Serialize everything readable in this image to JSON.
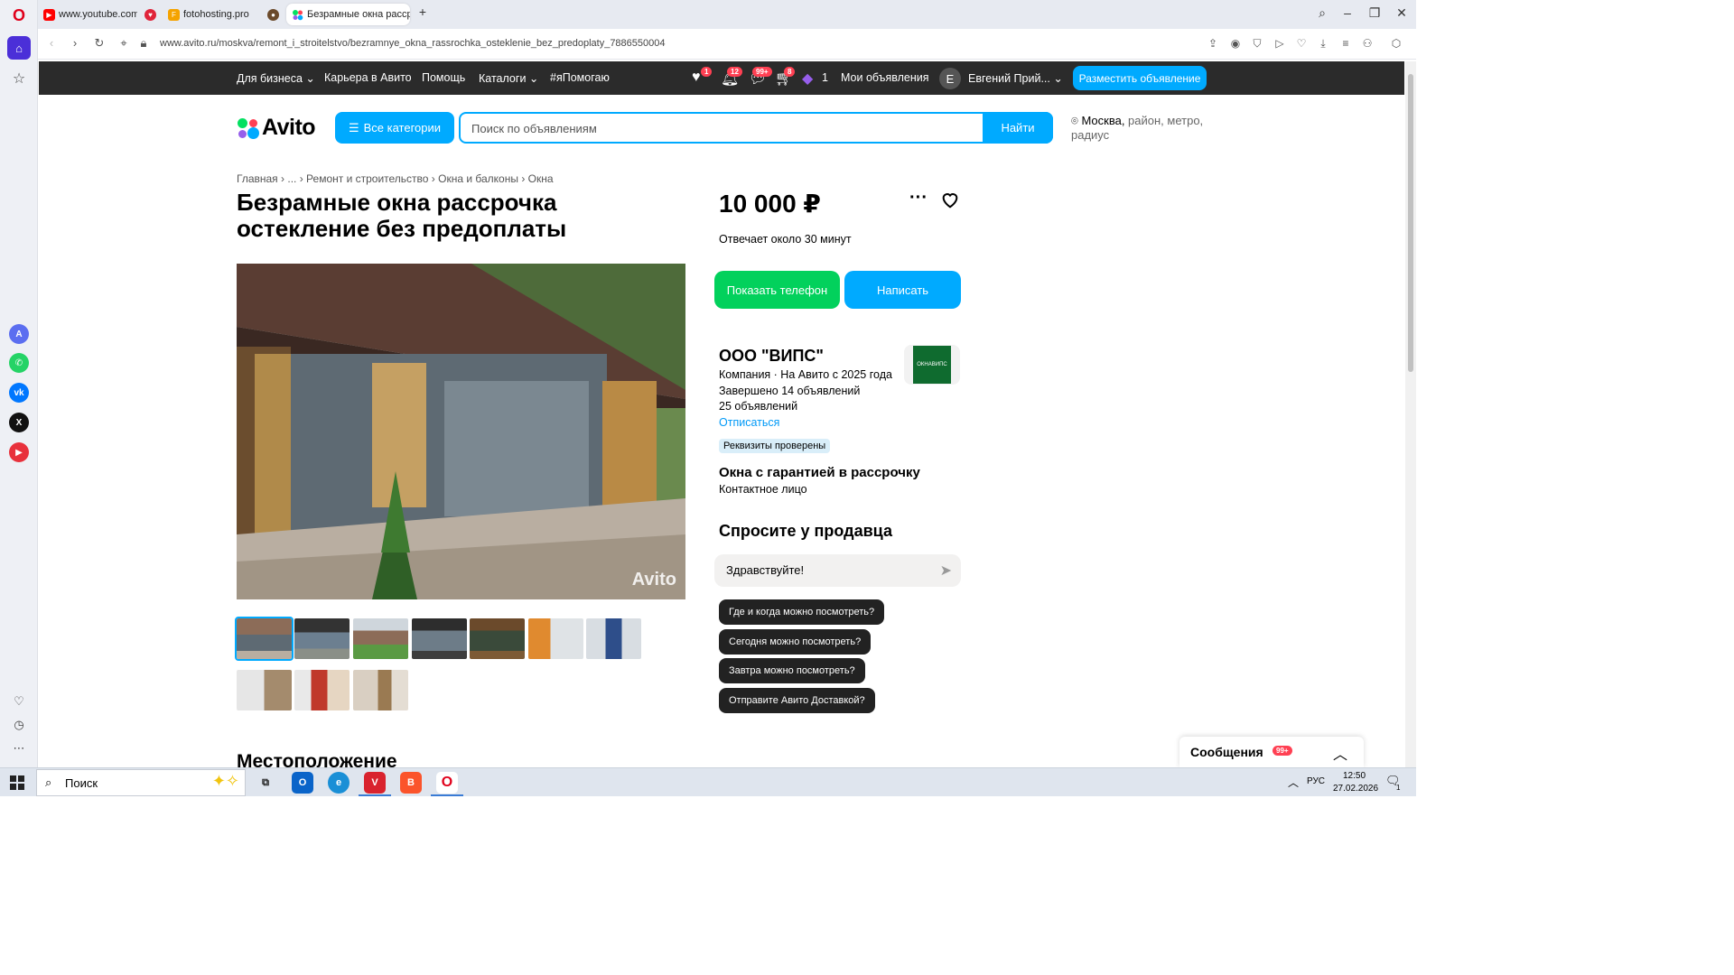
{
  "browser": {
    "tabs": [
      {
        "label": "www.youtube.com",
        "favicon": "youtube-icon"
      },
      {
        "label": "",
        "favicon": "heart-icon"
      },
      {
        "label": "fotohosting.pro",
        "favicon": "fotohosting-icon"
      },
      {
        "label": "",
        "favicon": "cookie-icon"
      },
      {
        "label": "Безрамные окна рассро...",
        "favicon": "avito-icon"
      }
    ],
    "url": "www.avito.ru/moskva/remont_i_stroitelstvo/bezramnye_okna_rassrochka_osteklenie_bez_predoplaty_7886550004"
  },
  "avito_topbar": {
    "business": "Для бизнеса",
    "career": "Карьера в Авито",
    "help": "Помощь",
    "catalogs": "Каталоги",
    "help_tag": "#яПомогаю",
    "badges": {
      "favorites": "1",
      "notifications": "12",
      "messages": "99+",
      "cart": "8"
    },
    "bonus_count": "1",
    "my_ads": "Мои объявления",
    "avatar_letter": "Е",
    "user_name": "Евгений Прий...",
    "post_ad": "Разместить объявление"
  },
  "header": {
    "logo": "Avito",
    "all_categories": "Все категории",
    "search_placeholder": "Поиск по объявлениям",
    "search_button": "Найти",
    "location_city": "Москва,",
    "location_rest": " район, метро, радиус"
  },
  "breadcrumb": [
    "Главная",
    "...",
    "Ремонт и строительство",
    "Окна и балконы",
    "Окна"
  ],
  "title": "Безрамные окна рассрочка остекление без предоплаты",
  "photo_watermark": "Avito",
  "section_location": "Местоположение",
  "offer": {
    "price": "10 000 ₽",
    "response_time": "Отвечает около 30 минут",
    "show_phone": "Показать телефон",
    "write": "Написать"
  },
  "seller": {
    "name": "ООО \"ВИПС\"",
    "type": "Компания · На Авито с 2025 года",
    "completed": "Завершено 14 объявлений",
    "ads_count": "25 объявлений",
    "unsubscribe": "Отписаться",
    "verified": "Реквизиты проверены",
    "logo_text": "ОКНАВИПС",
    "description": "Окна с гарантией в рассрочку",
    "contact": "Контактное лицо"
  },
  "ask": {
    "title": "Спросите у продавца",
    "input_value": "Здравствуйте!",
    "chips": [
      "Где и когда можно посмотреть?",
      "Сегодня можно посмотреть?",
      "Завтра можно посмотреть?",
      "Отправите Авито Доставкой?"
    ]
  },
  "messages_widget": {
    "label": "Сообщения",
    "badge": "99+"
  },
  "taskbar": {
    "search": "Поиск",
    "lang": "РУС",
    "time": "12:50",
    "date": "27.02.2026",
    "notif": "1"
  },
  "colors": {
    "avito_blue": "#00aaff",
    "avito_green": "#02d15c",
    "topbar": "#2b2b2b",
    "badge_red": "#ff4053"
  }
}
